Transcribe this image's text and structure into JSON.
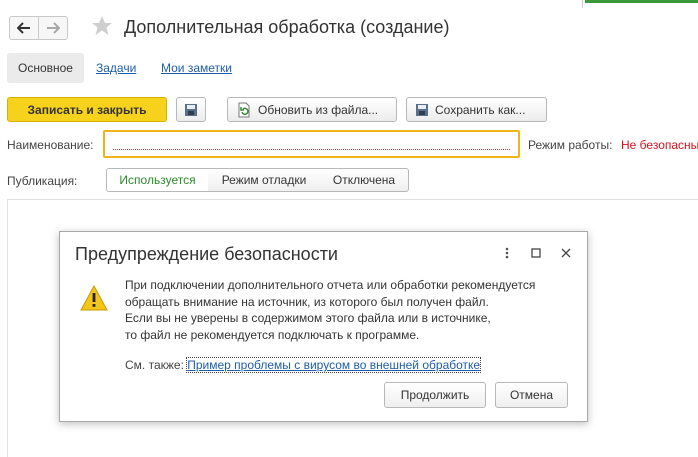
{
  "header": {
    "title": "Дополнительная обработка (создание)"
  },
  "tabs": {
    "main": "Основное",
    "tasks": "Задачи",
    "notes": "Мои заметки"
  },
  "toolbar": {
    "save_close": "Записать и закрыть",
    "update_from_file": "Обновить из файла...",
    "save_as": "Сохранить как..."
  },
  "form": {
    "name_label": "Наименование:",
    "name_value": "",
    "mode_label": "Режим работы:",
    "mode_value": "Не безопасный",
    "publication_label": "Публикация:",
    "publication_options": [
      "Используется",
      "Режим отладки",
      "Отключена"
    ]
  },
  "dialog": {
    "title": "Предупреждение безопасности",
    "message_lines": [
      "При подключении дополнительного отчета или обработки рекомендуется",
      "обращать внимание на источник, из которого был получен файл.",
      "Если вы не уверены в содержимом этого файла или в источнике,",
      "то файл не рекомендуется подключать к программе."
    ],
    "see_also_label": "См. также:",
    "see_also_link": "Пример проблемы с вирусом во внешней обработке",
    "continue_button": "Продолжить",
    "cancel_button": "Отмена"
  },
  "colors": {
    "primary_button": "#f7d21c",
    "link": "#1e5ea8",
    "danger_text": "#d8121c",
    "active_segment_text": "#2a8a2a",
    "input_focus_border": "#f0b418"
  }
}
